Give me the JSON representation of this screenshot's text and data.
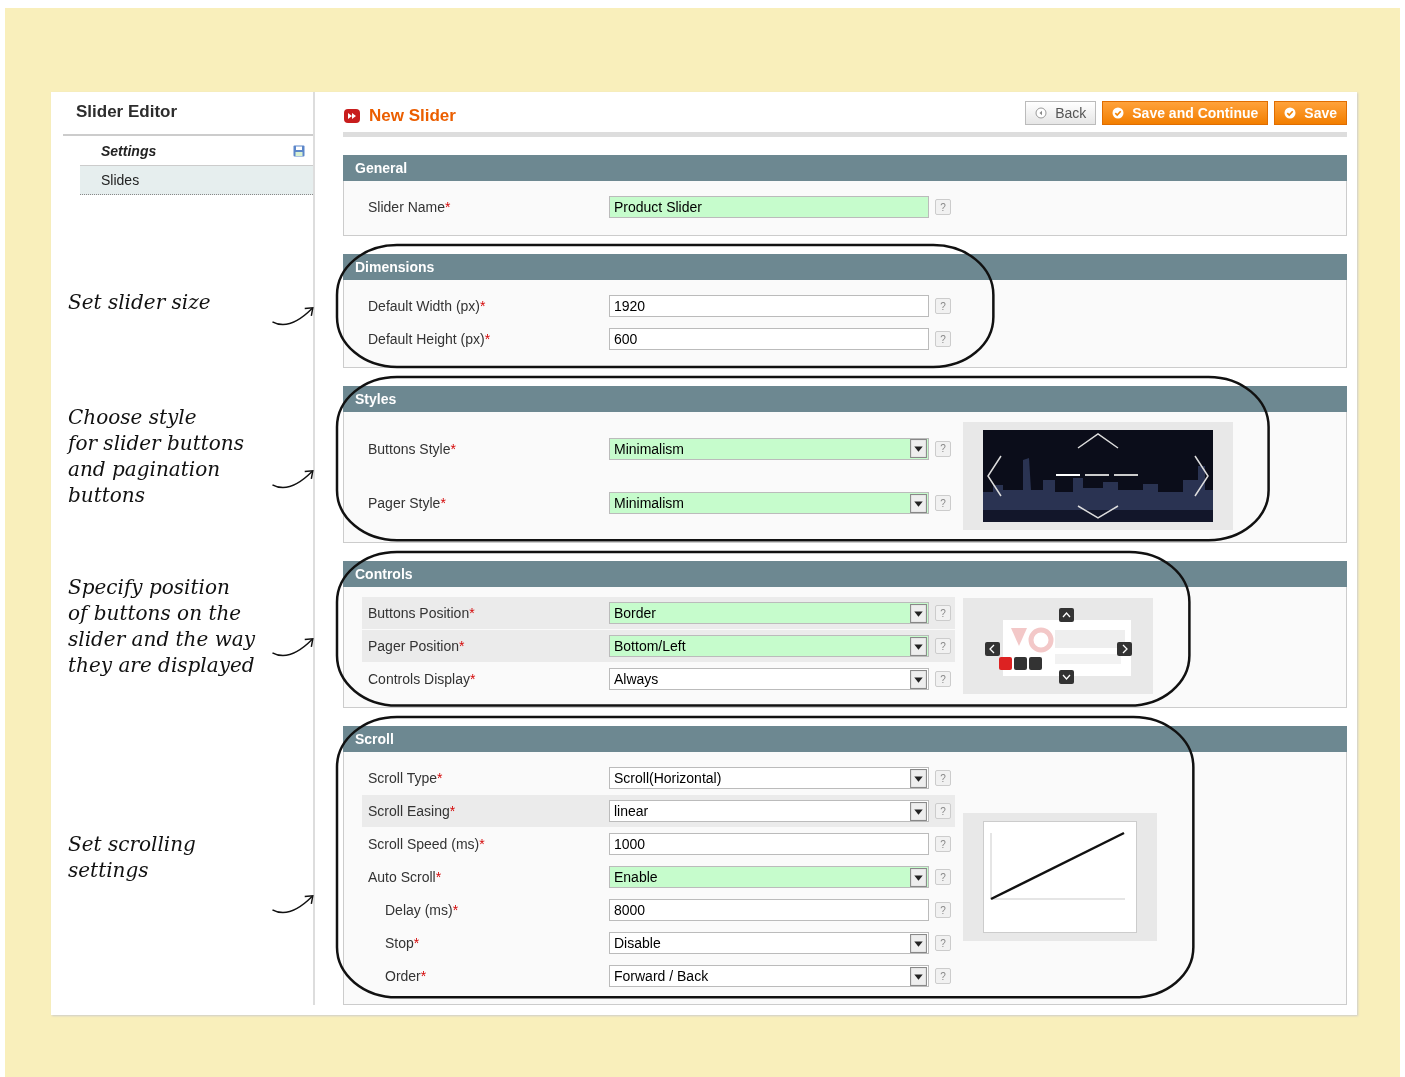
{
  "sidebar": {
    "title": "Slider Editor",
    "tabs": [
      {
        "label": "Settings",
        "selected": true,
        "changed": true
      },
      {
        "label": "Slides",
        "selected": false,
        "changed": false
      }
    ]
  },
  "page": {
    "title": "New Slider",
    "buttons": [
      {
        "label": "Back",
        "kind": "secondary"
      },
      {
        "label": "Save and Continue",
        "kind": "primary"
      },
      {
        "label": "Save",
        "kind": "primary"
      }
    ]
  },
  "sections": [
    {
      "title": "General",
      "circled": false,
      "fields": [
        {
          "label": "Slider Name",
          "required_mark": "*",
          "kind": "text",
          "value": "Product Slider",
          "highlighted": true,
          "shaded": false,
          "help": "?"
        }
      ]
    },
    {
      "title": "Dimensions",
      "circled": true,
      "note": "Set slider size",
      "fields": [
        {
          "label": "Default Width (px)",
          "required_mark": "*",
          "kind": "text",
          "value": "1920",
          "highlighted": false,
          "shaded": false,
          "help": "?"
        },
        {
          "label": "Default Height (px)",
          "required_mark": "*",
          "kind": "text",
          "value": "600",
          "highlighted": false,
          "shaded": false,
          "help": "?"
        }
      ]
    },
    {
      "title": "Styles",
      "circled": true,
      "note": "Choose style\nfor slider buttons\nand pagination\nbuttons",
      "preview": {
        "kind": "photo"
      },
      "fields": [
        {
          "label": "Buttons Style",
          "required_mark": "*",
          "kind": "select",
          "value": "Minimalism",
          "highlighted": true,
          "shaded": false,
          "help": "?"
        },
        {
          "label": "Pager Style",
          "required_mark": "*",
          "kind": "select",
          "value": "Minimalism",
          "highlighted": true,
          "shaded": false,
          "help": "?"
        }
      ]
    },
    {
      "title": "Controls",
      "circled": true,
      "note": "Specify position\nof buttons on the\nslider and the way\nthey are displayed",
      "preview": {
        "kind": "controls"
      },
      "fields": [
        {
          "label": "Buttons Position",
          "required_mark": "*",
          "kind": "select",
          "value": "Border",
          "highlighted": true,
          "shaded": true,
          "help": "?"
        },
        {
          "label": "Pager Position",
          "required_mark": "*",
          "kind": "select",
          "value": "Bottom/Left",
          "highlighted": true,
          "shaded": true,
          "help": "?"
        },
        {
          "label": "Controls Display",
          "required_mark": "*",
          "kind": "select",
          "value": "Always",
          "highlighted": false,
          "shaded": false,
          "help": "?"
        }
      ]
    },
    {
      "title": "Scroll",
      "circled": true,
      "note": "Set scrolling\nsettings",
      "preview": {
        "kind": "easing"
      },
      "fields": [
        {
          "label": "Scroll Type",
          "required_mark": "*",
          "kind": "select",
          "value": "Scroll(Horizontal)",
          "highlighted": false,
          "shaded": false,
          "help": "?"
        },
        {
          "label": "Scroll Easing",
          "required_mark": "*",
          "kind": "select",
          "value": "linear",
          "highlighted": false,
          "shaded": true,
          "help": "?"
        },
        {
          "label": "Scroll Speed (ms)",
          "required_mark": "*",
          "kind": "text",
          "value": "1000",
          "highlighted": false,
          "shaded": false,
          "help": "?"
        },
        {
          "label": "Auto Scroll",
          "required_mark": "*",
          "kind": "select",
          "value": "Enable",
          "highlighted": true,
          "shaded": false,
          "help": "?",
          "children": [
            {
              "label": "Delay (ms)",
              "required_mark": "*",
              "kind": "text",
              "value": "8000",
              "highlighted": false,
              "shaded": false,
              "help": "?"
            },
            {
              "label": "Stop",
              "required_mark": "*",
              "kind": "select",
              "value": "Disable",
              "highlighted": false,
              "shaded": false,
              "help": "?"
            },
            {
              "label": "Order",
              "required_mark": "*",
              "kind": "select",
              "value": "Forward / Back",
              "highlighted": false,
              "shaded": false,
              "help": "?"
            }
          ]
        }
      ]
    }
  ]
}
